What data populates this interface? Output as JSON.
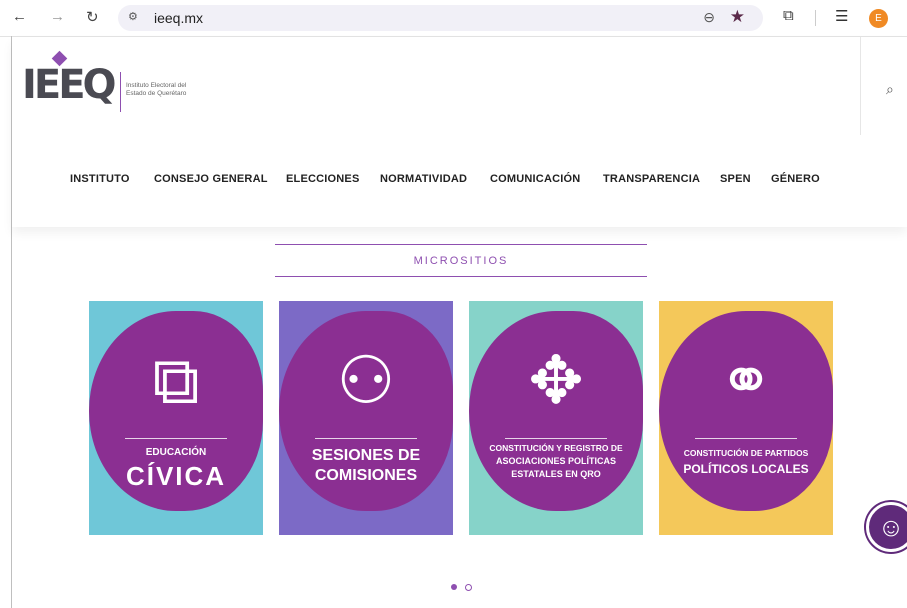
{
  "browser": {
    "url": "ieeq.mx",
    "avatar_letter": "E",
    "back_icon": "←",
    "forward_icon": "→",
    "reload_icon": "↻",
    "site_icon": "⚙",
    "zoom_icon": "⊖",
    "star_icon": "★",
    "ext_icon": "⧉",
    "media_icon": "☰"
  },
  "header": {
    "logo_letters": "IEEQ",
    "logo_line1": "Instituto Electoral del",
    "logo_line2": "Estado de Querétaro",
    "search_icon": "⌕",
    "menu": [
      "INSTITUTO",
      "CONSEJO GENERAL",
      "ELECCIONES",
      "NORMATIVIDAD",
      "COMUNICACIÓN",
      "TRANSPARENCIA",
      "SPEN",
      "GÉNERO"
    ]
  },
  "section": {
    "title": "MICROSITIOS"
  },
  "cards": [
    {
      "line1": "EDUCACIÓN",
      "line2": "CÍVICA",
      "icon": "puzzle-hand-icon",
      "glyph": "⧉",
      "bg": "#6fc7d8"
    },
    {
      "line1": "SESIONES DE",
      "line2": "COMISIONES",
      "icon": "meeting-flow-icon",
      "glyph": "⚇",
      "bg": "#7c6ac6"
    },
    {
      "line1": "CONSTITUCIÓN Y REGISTRO DE",
      "line2": "ASOCIACIONES POLÍTICAS",
      "line3": "ESTATALES EN QRO",
      "icon": "round-table-icon",
      "glyph": "✥",
      "bg": "#86d3c9"
    },
    {
      "line1": "CONSTITUCIÓN DE PARTIDOS",
      "line2": "POLÍTICOS LOCALES",
      "icon": "network-people-icon",
      "glyph": "⚭",
      "bg": "#f4c85a"
    }
  ],
  "carousel": {
    "active": 0,
    "total": 2,
    "active_color": "#8e4fb0"
  },
  "colors": {
    "purple": "#8b2f92",
    "accent": "#8e4fb0"
  },
  "accessibility_icon": "☺"
}
